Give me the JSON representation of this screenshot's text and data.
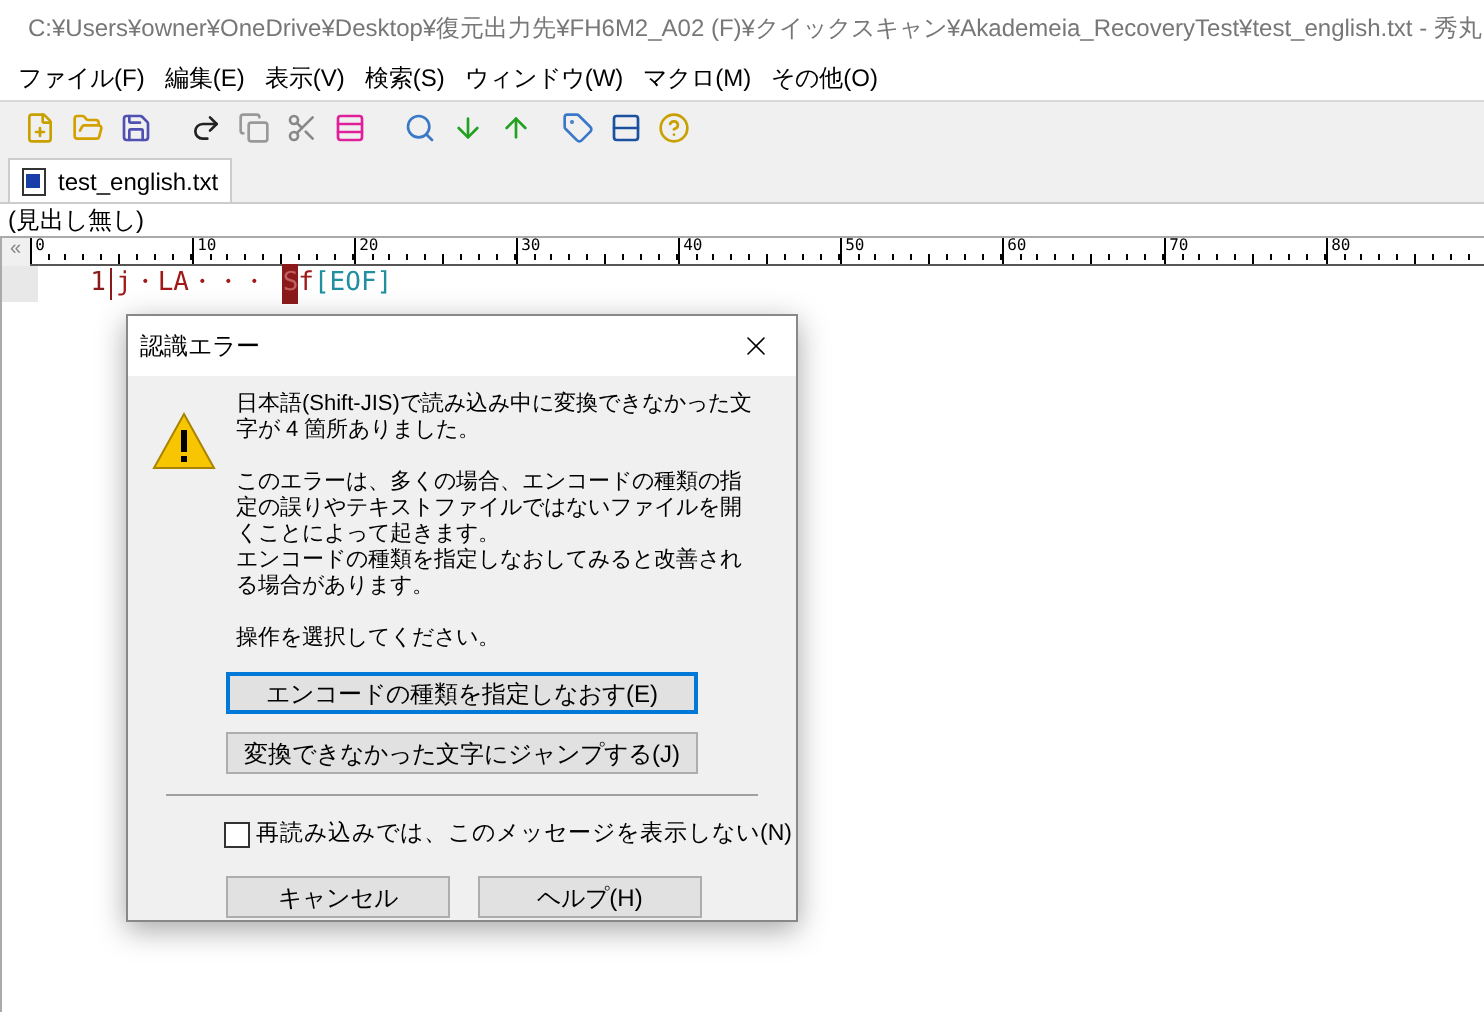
{
  "window": {
    "title": "C:¥Users¥owner¥OneDrive¥Desktop¥復元出力先¥FH6M2_A02 (F)¥クイックスキャン¥Akademeia_RecoveryTest¥test_english.txt  - 秀丸"
  },
  "menu": [
    "ファイル(F)",
    "編集(E)",
    "表示(V)",
    "検索(S)",
    "ウィンドウ(W)",
    "マクロ(M)",
    "その他(O)"
  ],
  "tabs": [
    {
      "label": "test_english.txt",
      "selected": true
    }
  ],
  "heading_label": "(見出し無し)",
  "ruler": {
    "scroll_mark": "«",
    "labels": [
      "0",
      "10",
      "20",
      "30",
      "40",
      "50",
      "60",
      "70",
      "80"
    ]
  },
  "editor": {
    "lines": [
      {
        "number": "1",
        "segments": [
          {
            "text": "j・LA・・・ ",
            "kind": "text"
          },
          {
            "text": "S",
            "kind": "error"
          },
          {
            "text": "f",
            "kind": "text"
          },
          {
            "text": "[EOF]",
            "kind": "eof"
          }
        ]
      }
    ]
  },
  "dialog": {
    "title": "認識エラー",
    "messages": [
      [
        "日本語(Shift-JIS)で読み込み中に変換できなかった文字が 4 箇所ありました。"
      ],
      [
        "このエラーは、多くの場合、エンコードの種類の指定の誤りやテキストファイルではないファイルを開くことによって起きます。",
        "エンコードの種類を指定しなおしてみると改善される場合があります。"
      ],
      [
        "操作を選択してください。"
      ]
    ],
    "actions": [
      {
        "label": "エンコードの種類を指定しなおす(E)",
        "default": true
      },
      {
        "label": "変換できなかった文字にジャンプする(J)",
        "default": false
      }
    ],
    "checkbox": {
      "label": "再読み込みでは、このメッセージを表示しない(N)",
      "checked": false
    },
    "buttons": [
      {
        "label": "キャンセル",
        "default": false
      },
      {
        "label": "ヘルプ(H)",
        "default": false
      }
    ]
  }
}
